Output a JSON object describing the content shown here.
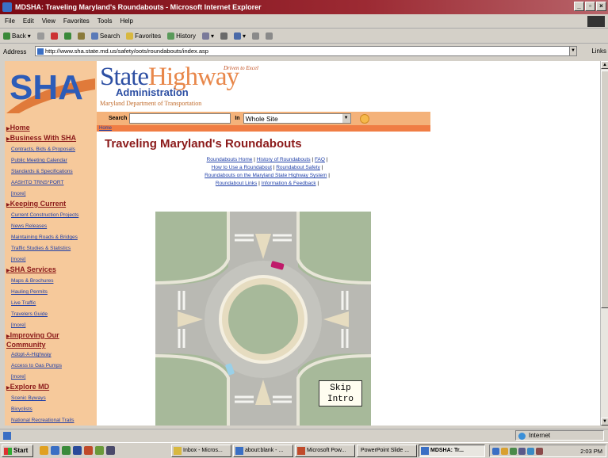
{
  "window": {
    "title": "MDSHA: Traveling Maryland's Roundabouts - Microsoft Internet Explorer",
    "controls": [
      "_",
      "▫",
      "×"
    ]
  },
  "menu": [
    "File",
    "Edit",
    "View",
    "Favorites",
    "Tools",
    "Help"
  ],
  "toolbar": {
    "back": "Back",
    "search": "Search",
    "favorites": "Favorites",
    "history": "History"
  },
  "address": {
    "label": "Address",
    "url": "http://www.sha.state.md.us/safety/oots/roundabouts/index.asp",
    "links": "Links"
  },
  "site": {
    "logo_text": "SHA",
    "brand_state": "State",
    "brand_highway": "Highway",
    "brand_admin": "Administration",
    "brand_mdot": "Maryland Department of Transportation",
    "tagline": "Driven to Excel",
    "search_label": "Search",
    "in_label": "In",
    "search_scope": "Whole Site",
    "breadcrumb": "Home"
  },
  "nav": [
    {
      "head": "Home",
      "items": []
    },
    {
      "head": "Business With SHA",
      "items": [
        "Contracts, Bids & Proposals",
        "Public Meeting Calendar",
        "Standards & Specifications",
        "AASHTO TRNS*PORT",
        "[more]"
      ]
    },
    {
      "head": "Keeping Current",
      "items": [
        "Current Construction Projects",
        "News Releases",
        "Maintaining Roads & Bridges",
        "Traffic Studies & Statistics",
        "[more]"
      ]
    },
    {
      "head": "SHA Services",
      "items": [
        "Maps & Brochures",
        "Hauling Permits",
        "Live Traffic",
        "Travelers Guide",
        "[more]"
      ]
    },
    {
      "head": "Improving Our Community",
      "items": [
        "Adopt-A-Highway",
        "Access to Gas Pumps",
        "[more]"
      ]
    },
    {
      "head": "Explore MD",
      "items": [
        "Scenic Byways",
        "Bicyclists",
        "National Recreational Trails"
      ]
    }
  ],
  "page": {
    "title": "Traveling Maryland's Roundabouts",
    "sublinks": [
      [
        "Roundabouts Home",
        "History of Roundabouts",
        "FAQ"
      ],
      [
        "How to Use a Roundabout",
        "Roundabout Safety"
      ],
      [
        "Roundabouts on the Maryland State Highway System"
      ],
      [
        "Roundabout Links",
        "Information & Feedback"
      ]
    ],
    "skip_intro_1": "Skip",
    "skip_intro_2": "Intro"
  },
  "status": {
    "zone": "Internet"
  },
  "taskbar": {
    "start": "Start",
    "tasks": [
      "Inbox - Micros...",
      "about:blank - ...",
      "Microsoft Pow...",
      "PowerPoint Slide ...",
      "MDSHA: Tr..."
    ],
    "clock": "2:03 PM"
  }
}
